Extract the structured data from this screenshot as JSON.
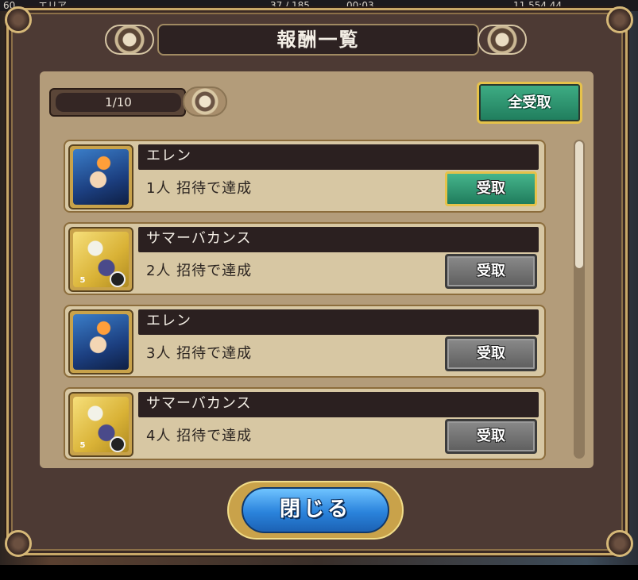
{
  "background": {
    "status_left": "60",
    "status_area": "エリア",
    "stamina": "37 / 185",
    "timer": "00:03",
    "coins": "11,554,44"
  },
  "dialog": {
    "title": "報酬一覧",
    "page": "1/10",
    "claim_all_label": "全受取",
    "close_label": "閉じる",
    "rewards": [
      {
        "name": "エレン",
        "condition": "1人 招待で達成",
        "button": "受取",
        "state": "active",
        "icon": "character-ellen-icon"
      },
      {
        "name": "サマーバカンス",
        "condition": "2人 招待で達成",
        "button": "受取",
        "state": "disabled",
        "icon": "item-summer-vacance-icon",
        "badge": "5"
      },
      {
        "name": "エレン",
        "condition": "3人 招待で達成",
        "button": "受取",
        "state": "disabled",
        "icon": "character-ellen-icon"
      },
      {
        "name": "サマーバカンス",
        "condition": "4人 招待で達成",
        "button": "受取",
        "state": "disabled",
        "icon": "item-summer-vacance-icon",
        "badge": "5"
      }
    ]
  },
  "colors": {
    "active_button": "#1f7c5c",
    "disabled_button": "#5e5e5e",
    "close_button": "#2a83dc",
    "frame_gold": "#c8a868"
  }
}
